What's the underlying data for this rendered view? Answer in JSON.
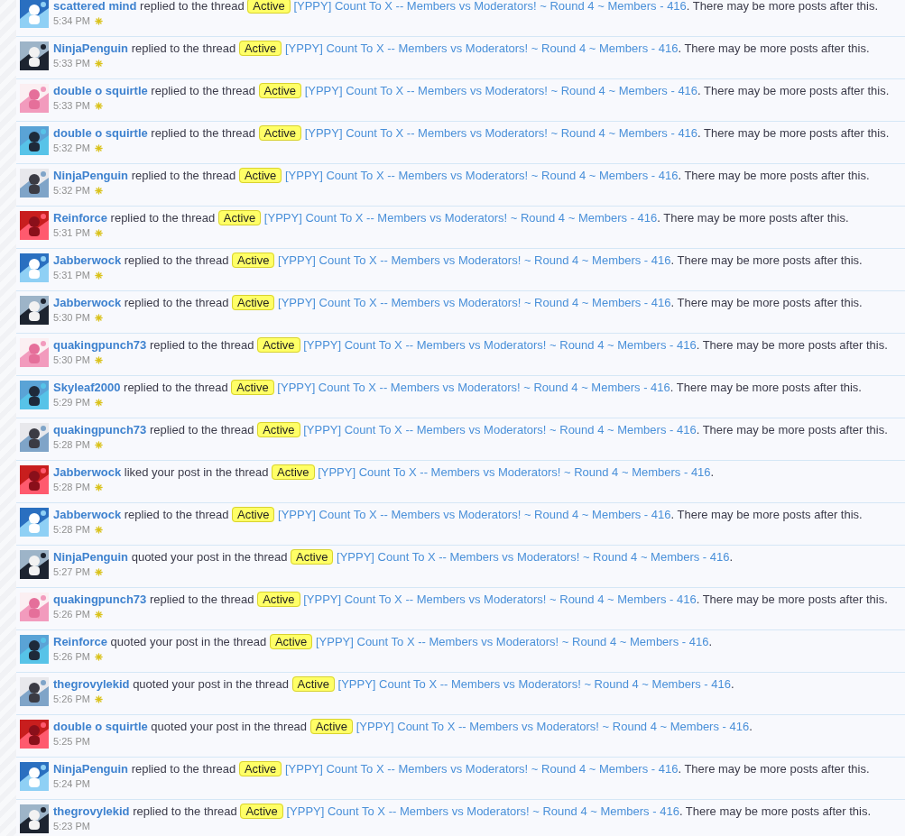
{
  "alerts": [
    {
      "user": "scattered mind",
      "action": "replied to the thread",
      "badge": "Active",
      "thread": "[YPPY] Count To X -- Members vs Moderators! ~ Round 4 ~ Members - 416",
      "after": ". There may be more posts after this.",
      "time": "5:34 PM",
      "new": true
    },
    {
      "user": "NinjaPenguin",
      "action": "replied to the thread",
      "badge": "Active",
      "thread": "[YPPY] Count To X -- Members vs Moderators! ~ Round 4 ~ Members - 416",
      "after": ". There may be more posts after this.",
      "time": "5:33 PM",
      "new": true
    },
    {
      "user": "double o squirtle",
      "action": "replied to the thread",
      "badge": "Active",
      "thread": "[YPPY] Count To X -- Members vs Moderators! ~ Round 4 ~ Members - 416",
      "after": ". There may be more posts after this.",
      "time": "5:33 PM",
      "new": true
    },
    {
      "user": "double o squirtle",
      "action": "replied to the thread",
      "badge": "Active",
      "thread": "[YPPY] Count To X -- Members vs Moderators! ~ Round 4 ~ Members - 416",
      "after": ". There may be more posts after this.",
      "time": "5:32 PM",
      "new": true
    },
    {
      "user": "NinjaPenguin",
      "action": "replied to the thread",
      "badge": "Active",
      "thread": "[YPPY] Count To X -- Members vs Moderators! ~ Round 4 ~ Members - 416",
      "after": ". There may be more posts after this.",
      "time": "5:32 PM",
      "new": true
    },
    {
      "user": "Reinforce",
      "action": "replied to the thread",
      "badge": "Active",
      "thread": "[YPPY] Count To X -- Members vs Moderators! ~ Round 4 ~ Members - 416",
      "after": ". There may be more posts after this.",
      "time": "5:31 PM",
      "new": true
    },
    {
      "user": "Jabberwock",
      "action": "replied to the thread",
      "badge": "Active",
      "thread": "[YPPY] Count To X -- Members vs Moderators! ~ Round 4 ~ Members - 416",
      "after": ". There may be more posts after this.",
      "time": "5:31 PM",
      "new": true
    },
    {
      "user": "Jabberwock",
      "action": "replied to the thread",
      "badge": "Active",
      "thread": "[YPPY] Count To X -- Members vs Moderators! ~ Round 4 ~ Members - 416",
      "after": ". There may be more posts after this.",
      "time": "5:30 PM",
      "new": true
    },
    {
      "user": "quakingpunch73",
      "action": "replied to the thread",
      "badge": "Active",
      "thread": "[YPPY] Count To X -- Members vs Moderators! ~ Round 4 ~ Members - 416",
      "after": ". There may be more posts after this.",
      "time": "5:30 PM",
      "new": true
    },
    {
      "user": "Skyleaf2000",
      "action": "replied to the thread",
      "badge": "Active",
      "thread": "[YPPY] Count To X -- Members vs Moderators! ~ Round 4 ~ Members - 416",
      "after": ". There may be more posts after this.",
      "time": "5:29 PM",
      "new": true
    },
    {
      "user": "quakingpunch73",
      "action": "replied to the thread",
      "badge": "Active",
      "thread": "[YPPY] Count To X -- Members vs Moderators! ~ Round 4 ~ Members - 416",
      "after": ". There may be more posts after this.",
      "time": "5:28 PM",
      "new": true
    },
    {
      "user": "Jabberwock",
      "action": "liked your post in the thread",
      "badge": "Active",
      "thread": "[YPPY] Count To X -- Members vs Moderators! ~ Round 4 ~ Members - 416",
      "after": ".",
      "time": "5:28 PM",
      "new": true
    },
    {
      "user": "Jabberwock",
      "action": "replied to the thread",
      "badge": "Active",
      "thread": "[YPPY] Count To X -- Members vs Moderators! ~ Round 4 ~ Members - 416",
      "after": ". There may be more posts after this.",
      "time": "5:28 PM",
      "new": true
    },
    {
      "user": "NinjaPenguin",
      "action": "quoted your post in the thread",
      "badge": "Active",
      "thread": "[YPPY] Count To X -- Members vs Moderators! ~ Round 4 ~ Members - 416",
      "after": ".",
      "time": "5:27 PM",
      "new": true
    },
    {
      "user": "quakingpunch73",
      "action": "replied to the thread",
      "badge": "Active",
      "thread": "[YPPY] Count To X -- Members vs Moderators! ~ Round 4 ~ Members - 416",
      "after": ". There may be more posts after this.",
      "time": "5:26 PM",
      "new": true
    },
    {
      "user": "Reinforce",
      "action": "quoted your post in the thread",
      "badge": "Active",
      "thread": "[YPPY] Count To X -- Members vs Moderators! ~ Round 4 ~ Members - 416",
      "after": ".",
      "time": "5:26 PM",
      "new": true
    },
    {
      "user": "thegrovylekid",
      "action": "quoted your post in the thread",
      "badge": "Active",
      "thread": "[YPPY] Count To X -- Members vs Moderators! ~ Round 4 ~ Members - 416",
      "after": ".",
      "time": "5:26 PM",
      "new": true
    },
    {
      "user": "double o squirtle",
      "action": "quoted your post in the thread",
      "badge": "Active",
      "thread": "[YPPY] Count To X -- Members vs Moderators! ~ Round 4 ~ Members - 416",
      "after": ".",
      "time": "5:25 PM",
      "new": false
    },
    {
      "user": "NinjaPenguin",
      "action": "replied to the thread",
      "badge": "Active",
      "thread": "[YPPY] Count To X -- Members vs Moderators! ~ Round 4 ~ Members - 416",
      "after": ". There may be more posts after this.",
      "time": "5:24 PM",
      "new": false
    },
    {
      "user": "thegrovylekid",
      "action": "replied to the thread",
      "badge": "Active",
      "thread": "[YPPY] Count To X -- Members vs Moderators! ~ Round 4 ~ Members - 416",
      "after": ". There may be more posts after this.",
      "time": "5:23 PM",
      "new": false
    }
  ]
}
